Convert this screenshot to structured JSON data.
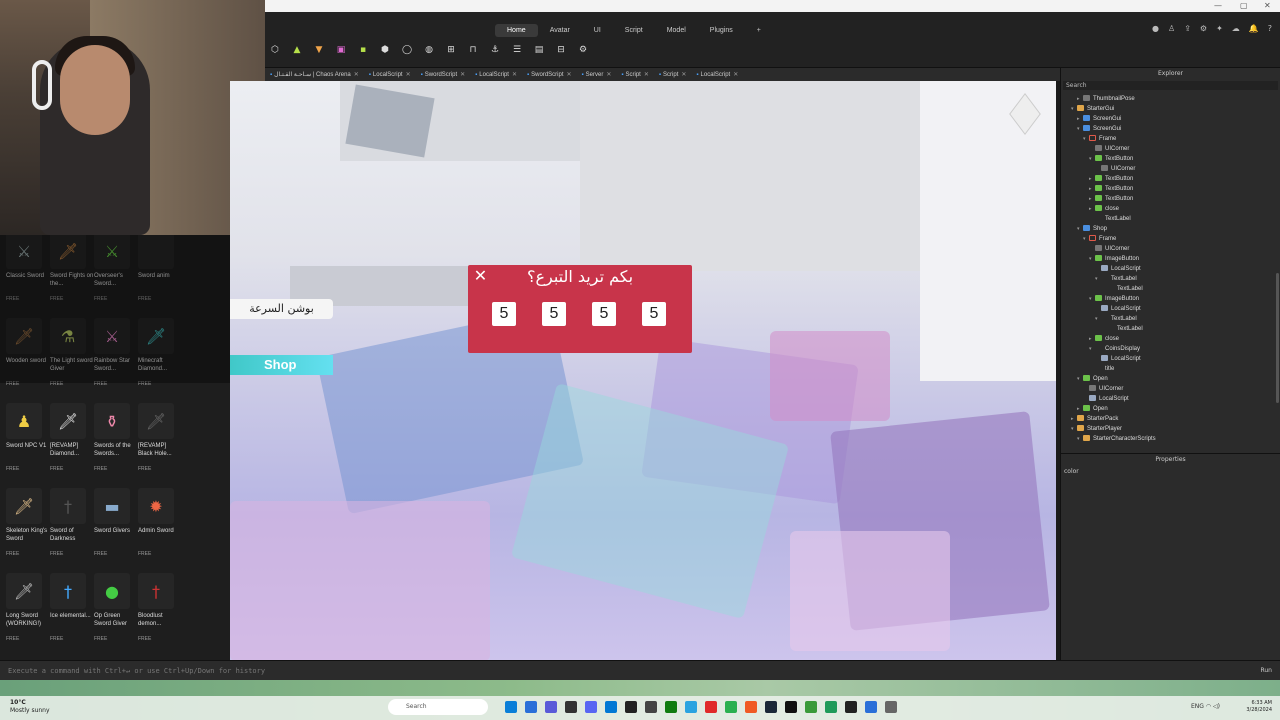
{
  "ribbon": {
    "tabs": [
      "Home",
      "Avatar",
      "UI",
      "Script",
      "Model",
      "Plugins",
      "+"
    ],
    "active_tab": "Home"
  },
  "script_tabs": [
    {
      "label": "سـاحـة القـتـال | Chaos Arena"
    },
    {
      "label": "LocalScript"
    },
    {
      "label": "SwordScript"
    },
    {
      "label": "LocalScript"
    },
    {
      "label": "SwordScript"
    },
    {
      "label": "Server"
    },
    {
      "label": "Script"
    },
    {
      "label": "Script"
    },
    {
      "label": "LocalScript"
    }
  ],
  "toolbox": {
    "items": [
      {
        "name": "Classic Sword",
        "badge": "FREE",
        "glyph": "⚔",
        "color": "#9aa"
      },
      {
        "name": "Sword Fights on the...",
        "badge": "FREE",
        "glyph": "🗡",
        "color": "#c84"
      },
      {
        "name": "Overseer's Sword...",
        "badge": "FREE",
        "glyph": "⚔",
        "color": "#6c4"
      },
      {
        "name": "Sword anim",
        "badge": "FREE",
        "glyph": "",
        "color": "#888"
      },
      {
        "name": "Wooden sword",
        "badge": "FREE",
        "glyph": "🗡",
        "color": "#a74"
      },
      {
        "name": "The Light sword Giver",
        "badge": "FREE",
        "glyph": "⚗",
        "color": "#bc6"
      },
      {
        "name": "Rainbow Star Sword...",
        "badge": "FREE",
        "glyph": "⚔",
        "color": "#e8c"
      },
      {
        "name": "Minecraft Diamond...",
        "badge": "FREE",
        "glyph": "🗡",
        "color": "#4cc"
      },
      {
        "name": "Sword NPC V1",
        "badge": "FREE",
        "glyph": "♟",
        "color": "#ec4"
      },
      {
        "name": "[REVAMP] Diamond...",
        "badge": "FREE",
        "glyph": "🗡",
        "color": "#ddd"
      },
      {
        "name": "Swords of the Swords...",
        "badge": "FREE",
        "glyph": "⚱",
        "color": "#e8a"
      },
      {
        "name": "[REVAMP] Black Hole...",
        "badge": "FREE",
        "glyph": "🗡",
        "color": "#666"
      },
      {
        "name": "Skeleton King's Sword",
        "badge": "FREE",
        "glyph": "🗡",
        "color": "#db8"
      },
      {
        "name": "Sword of Darkness",
        "badge": "FREE",
        "glyph": "†",
        "color": "#555"
      },
      {
        "name": "Sword Givers",
        "badge": "FREE",
        "glyph": "▬",
        "color": "#8ac"
      },
      {
        "name": "Admin Sword",
        "badge": "FREE",
        "glyph": "✹",
        "color": "#e64"
      },
      {
        "name": "Long Sword (WORKING!)",
        "badge": "FREE",
        "glyph": "🗡",
        "color": "#bbb"
      },
      {
        "name": "Ice elemental...",
        "badge": "FREE",
        "glyph": "†",
        "color": "#4af"
      },
      {
        "name": "Op Green Sword Giver",
        "badge": "FREE",
        "glyph": "●",
        "color": "#4c4"
      },
      {
        "name": "Bloodlust demon...",
        "badge": "FREE",
        "glyph": "†",
        "color": "#c33"
      }
    ]
  },
  "game_ui": {
    "speed_potion_label": "بوشن السرعة",
    "shop_label": "Shop",
    "dialog": {
      "title": "بكم تريد التبرع؟",
      "close_glyph": "✕",
      "amounts": [
        "5",
        "5",
        "5",
        "5"
      ]
    }
  },
  "explorer": {
    "title": "Explorer",
    "search_placeholder": "Search",
    "rows": [
      {
        "depth": 1,
        "arrow": "▸",
        "icon": "corner",
        "label": "ThumbnailPose"
      },
      {
        "depth": 0,
        "arrow": "▾",
        "icon": "folder",
        "label": "StarterGui"
      },
      {
        "depth": 1,
        "arrow": "▸",
        "icon": "gui",
        "label": "ScreenGui"
      },
      {
        "depth": 1,
        "arrow": "▾",
        "icon": "gui",
        "label": "ScreenGui"
      },
      {
        "depth": 2,
        "arrow": "▾",
        "icon": "frame",
        "label": "Frame"
      },
      {
        "depth": 3,
        "arrow": "",
        "icon": "corner",
        "label": "UICorner"
      },
      {
        "depth": 3,
        "arrow": "▾",
        "icon": "btn",
        "label": "TextButton"
      },
      {
        "depth": 4,
        "arrow": "",
        "icon": "corner",
        "label": "UICorner"
      },
      {
        "depth": 3,
        "arrow": "▸",
        "icon": "btn",
        "label": "TextButton"
      },
      {
        "depth": 3,
        "arrow": "▸",
        "icon": "btn",
        "label": "TextButton"
      },
      {
        "depth": 3,
        "arrow": "▸",
        "icon": "btn",
        "label": "TextButton"
      },
      {
        "depth": 3,
        "arrow": "▸",
        "icon": "btn",
        "label": "close"
      },
      {
        "depth": 3,
        "arrow": "",
        "icon": "label",
        "label": "TextLabel"
      },
      {
        "depth": 1,
        "arrow": "▾",
        "icon": "gui",
        "label": "Shop"
      },
      {
        "depth": 2,
        "arrow": "▾",
        "icon": "frame",
        "label": "Frame"
      },
      {
        "depth": 3,
        "arrow": "",
        "icon": "corner",
        "label": "UICorner"
      },
      {
        "depth": 3,
        "arrow": "▾",
        "icon": "btn",
        "label": "ImageButton"
      },
      {
        "depth": 4,
        "arrow": "",
        "icon": "script",
        "label": "LocalScript"
      },
      {
        "depth": 4,
        "arrow": "▾",
        "icon": "label",
        "label": "TextLabel"
      },
      {
        "depth": 5,
        "arrow": "",
        "icon": "label",
        "label": "TextLabel"
      },
      {
        "depth": 3,
        "arrow": "▾",
        "icon": "btn",
        "label": "ImageButton"
      },
      {
        "depth": 4,
        "arrow": "",
        "icon": "script",
        "label": "LocalScript"
      },
      {
        "depth": 4,
        "arrow": "▾",
        "icon": "label",
        "label": "TextLabel"
      },
      {
        "depth": 5,
        "arrow": "",
        "icon": "label",
        "label": "TextLabel"
      },
      {
        "depth": 3,
        "arrow": "▸",
        "icon": "btn",
        "label": "close"
      },
      {
        "depth": 3,
        "arrow": "▾",
        "icon": "label",
        "label": "CoinsDisplay"
      },
      {
        "depth": 4,
        "arrow": "",
        "icon": "script",
        "label": "LocalScript"
      },
      {
        "depth": 3,
        "arrow": "",
        "icon": "label",
        "label": "title"
      },
      {
        "depth": 1,
        "arrow": "▾",
        "icon": "btn",
        "label": "Open"
      },
      {
        "depth": 2,
        "arrow": "",
        "icon": "corner",
        "label": "UICorner"
      },
      {
        "depth": 2,
        "arrow": "",
        "icon": "script",
        "label": "LocalScript"
      },
      {
        "depth": 1,
        "arrow": "▸",
        "icon": "btn",
        "label": "Open"
      },
      {
        "depth": 0,
        "arrow": "▸",
        "icon": "folder",
        "label": "StarterPack"
      },
      {
        "depth": 0,
        "arrow": "▾",
        "icon": "folder",
        "label": "StarterPlayer"
      },
      {
        "depth": 1,
        "arrow": "▾",
        "icon": "folder",
        "label": "StarterCharacterScripts"
      }
    ]
  },
  "properties": {
    "title": "Properties",
    "filter_value": "color"
  },
  "command_bar": {
    "placeholder": "Execute a command with Ctrl+↵ or use Ctrl+Up/Down for history",
    "run_label": "Run"
  },
  "taskbar": {
    "temperature": "10°C",
    "weather": "Mostly sunny",
    "search_placeholder": "Search",
    "language": "ENG",
    "time": "6:33 AM",
    "date": "3/28/2024"
  }
}
